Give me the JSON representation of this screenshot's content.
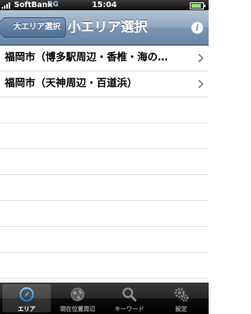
{
  "status_bar": {
    "carrier": "SoftBank",
    "network": "3G",
    "time": "15:04"
  },
  "nav": {
    "back_label": "大エリア選択",
    "title": "小エリア選択",
    "info_icon": "i"
  },
  "list": {
    "items": [
      {
        "label": "福岡市（博多駅周辺・香椎・海の…"
      },
      {
        "label": "福岡市（天神周辺・百道浜）"
      }
    ]
  },
  "tabbar": {
    "tabs": [
      {
        "label": "エリア",
        "icon": "compass-icon",
        "active": true
      },
      {
        "label": "現在位置周辺",
        "icon": "globe-icon",
        "active": false
      },
      {
        "label": "キーワード",
        "icon": "magnifier-icon",
        "active": false
      },
      {
        "label": "設定",
        "icon": "gears-icon",
        "active": false
      }
    ]
  },
  "colors": {
    "nav_bar": "#7a93b0",
    "tab_active": "#ffffff",
    "tab_inactive": "#9b9b9b",
    "accent_blue": "#2a9bf0"
  }
}
